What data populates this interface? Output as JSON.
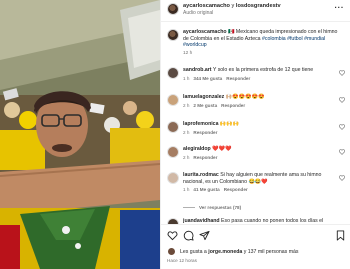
{
  "header": {
    "username": "aycarloscamacho",
    "connector": "y",
    "coauthor": "losdosgrandestv",
    "subtitle": "Audio original",
    "more_icon": "more-horizontal-icon"
  },
  "caption": {
    "username": "aycarloscamacho",
    "emoji": "🇲🇽",
    "text": " Mexicano queda impresionado con el himno de Colombia en el Estadio Azteca ",
    "tags": "#colombia #futbol #mundial #worldcup",
    "time": "12 h"
  },
  "comments": [
    {
      "user": "sandrob.art",
      "text": " Y solo es la primera estrofa de 12 que tiene",
      "time": "1 h",
      "likes": "344 Me gusta",
      "reply": "Responder"
    },
    {
      "user": "lamuelagonzalez",
      "text": " 🙌🏼😍😍😍😍😍",
      "time": "2 h",
      "likes": "2 Me gusta",
      "reply": "Responder"
    },
    {
      "user": "laprofemonica",
      "text": " 🙌🙌🙌",
      "time": "2 h",
      "likes": "",
      "reply": "Responder"
    },
    {
      "user": "alegiraldop",
      "text": " ❤️❤️❤️",
      "time": "2 h",
      "likes": "",
      "reply": "Responder"
    },
    {
      "user": "laurita.rodmac",
      "text": " Si hay alguien que realmente ama su himno nacional, es un Colombiano 😂😂❤️",
      "time": "1 h",
      "likes": "41 Me gusta",
      "reply": "Responder"
    },
    {
      "user": "juandavidhand",
      "text": " Eso pasa cuando no ponen todos los días el",
      "time": "",
      "likes": "",
      "reply": ""
    }
  ],
  "view_replies": "Ver respuestas (78)",
  "footer": {
    "likes_prefix": "Les gusta a ",
    "liked_by": "jorge.moneda",
    "likes_suffix": " y 137 mil personas más",
    "time_ago": "Hace 12 horas"
  },
  "colors": {
    "link": "#00376b",
    "muted": "#737373",
    "text": "#262626",
    "divider": "#efefef"
  }
}
